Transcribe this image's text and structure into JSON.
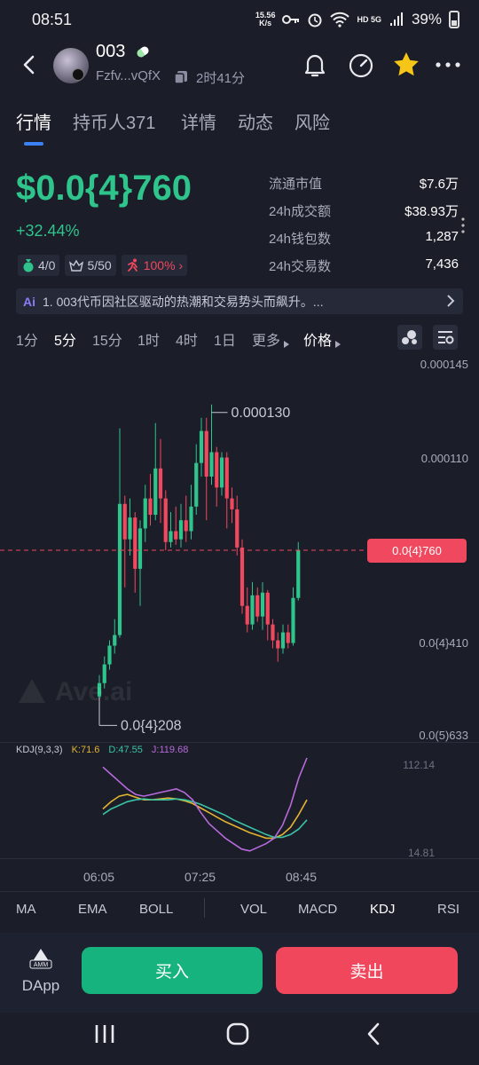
{
  "status_bar": {
    "time": "08:51",
    "speed_value": "15.56",
    "speed_unit": "K/s",
    "network": "HD 5G",
    "battery": "39%"
  },
  "header": {
    "token_name": "003",
    "address": "Fzfv...vQfX",
    "age": "2时41分"
  },
  "tabs": [
    {
      "label": "行情"
    },
    {
      "label": "持币人371"
    },
    {
      "label": "详情"
    },
    {
      "label": "动态"
    },
    {
      "label": "风险"
    }
  ],
  "price": {
    "value": "$0.0{4}760",
    "change": "+32.44%"
  },
  "badges": [
    {
      "text": "4/0"
    },
    {
      "text": "5/50"
    },
    {
      "text": "100%"
    }
  ],
  "stats": [
    {
      "label": "流通市值",
      "value": "$7.6万"
    },
    {
      "label": "24h成交额",
      "value": "$38.93万"
    },
    {
      "label": "24h钱包数",
      "value": "1,287"
    },
    {
      "label": "24h交易数",
      "value": "7,436"
    }
  ],
  "ai_banner": {
    "tag": "Ai",
    "text": "1. 003代币因社区驱动的热潮和交易势头而飙升。..."
  },
  "intervals": [
    {
      "label": "1分"
    },
    {
      "label": "5分"
    },
    {
      "label": "15分"
    },
    {
      "label": "1时"
    },
    {
      "label": "4时"
    },
    {
      "label": "1日"
    },
    {
      "label": "更多"
    },
    {
      "label": "价格"
    }
  ],
  "chart_data": {
    "type": "candlestick",
    "interval": "5分",
    "y_ticks": [
      "0.000145",
      "0.000110",
      "0.0{4}760",
      "0.0{4}410",
      "0.0(5)633"
    ],
    "y_tick_values": [
      0.000145,
      0.00011,
      7.6e-05,
      4.1e-05,
      6.33e-06
    ],
    "current_price_label": "0.0{4}760",
    "current_price": 7.6e-05,
    "high_label": "0.000130",
    "low_label": "0.0{4}208",
    "x_ticks": [
      "06:05",
      "07:25",
      "08:45"
    ],
    "candles": [
      {
        "o": 2.1e-05,
        "c": 2.6e-05,
        "h": 2.9e-05,
        "l": 2.08e-05
      },
      {
        "o": 2.6e-05,
        "c": 3.3e-05,
        "h": 3.6e-05,
        "l": 2.4e-05
      },
      {
        "o": 3.3e-05,
        "c": 4e-05,
        "h": 4.2e-05,
        "l": 3.1e-05
      },
      {
        "o": 4e-05,
        "c": 4.4e-05,
        "h": 5e-05,
        "l": 3.7e-05
      },
      {
        "o": 4.4e-05,
        "c": 9.3e-05,
        "h": 0.000121,
        "l": 4.3e-05
      },
      {
        "o": 9.3e-05,
        "c": 8e-05,
        "h": 9.6e-05,
        "l": 6.2e-05
      },
      {
        "o": 8e-05,
        "c": 8.8e-05,
        "h": 9.5e-05,
        "l": 7.4e-05
      },
      {
        "o": 8.8e-05,
        "c": 6.9e-05,
        "h": 9e-05,
        "l": 6e-05
      },
      {
        "o": 6.9e-05,
        "c": 8.4e-05,
        "h": 8.7e-05,
        "l": 5.5e-05
      },
      {
        "o": 8.4e-05,
        "c": 9.5e-05,
        "h": 0.0001,
        "l": 7.9e-05
      },
      {
        "o": 9.5e-05,
        "c": 8.9e-05,
        "h": 0.000104,
        "l": 8.5e-05
      },
      {
        "o": 8.9e-05,
        "c": 0.000106,
        "h": 0.000123,
        "l": 8.7e-05
      },
      {
        "o": 0.000106,
        "c": 9.5e-05,
        "h": 0.000117,
        "l": 8.6e-05
      },
      {
        "o": 9.5e-05,
        "c": 7.9e-05,
        "h": 9.8e-05,
        "l": 7.6e-05
      },
      {
        "o": 7.9e-05,
        "c": 8.3e-05,
        "h": 9e-05,
        "l": 7.7e-05
      },
      {
        "o": 8.3e-05,
        "c": 8e-05,
        "h": 9.2e-05,
        "l": 7.8e-05
      },
      {
        "o": 8e-05,
        "c": 8.7e-05,
        "h": 9.3e-05,
        "l": 7.7e-05
      },
      {
        "o": 8.7e-05,
        "c": 8.3e-05,
        "h": 9.6e-05,
        "l": 7.9e-05
      },
      {
        "o": 8.3e-05,
        "c": 9.2e-05,
        "h": 0.0001,
        "l": 8e-05
      },
      {
        "o": 9.2e-05,
        "c": 0.000108,
        "h": 0.000115,
        "l": 8.9e-05
      },
      {
        "o": 0.000108,
        "c": 0.00012,
        "h": 0.000125,
        "l": 0.000103
      },
      {
        "o": 0.00012,
        "c": 0.000103,
        "h": 0.000125,
        "l": 8.7e-05
      },
      {
        "o": 0.000103,
        "c": 0.000112,
        "h": 0.00013,
        "l": 0.0001
      },
      {
        "o": 0.000112,
        "c": 9.9e-05,
        "h": 0.000114,
        "l": 9.2e-05
      },
      {
        "o": 9.9e-05,
        "c": 0.00011,
        "h": 0.000112,
        "l": 9.6e-05
      },
      {
        "o": 0.00011,
        "c": 9.5e-05,
        "h": 0.000112,
        "l": 8.4e-05
      },
      {
        "o": 9.5e-05,
        "c": 9.1e-05,
        "h": 9.9e-05,
        "l": 8.6e-05
      },
      {
        "o": 9.1e-05,
        "c": 7.7e-05,
        "h": 9.6e-05,
        "l": 7.4e-05
      },
      {
        "o": 7.7e-05,
        "c": 5.5e-05,
        "h": 8e-05,
        "l": 5.2e-05
      },
      {
        "o": 5.5e-05,
        "c": 4.8e-05,
        "h": 6.2e-05,
        "l": 4.5e-05
      },
      {
        "o": 4.8e-05,
        "c": 5.9e-05,
        "h": 6.4e-05,
        "l": 4.6e-05
      },
      {
        "o": 5.9e-05,
        "c": 5.1e-05,
        "h": 6.2e-05,
        "l": 4.9e-05
      },
      {
        "o": 5.1e-05,
        "c": 6e-05,
        "h": 6.4e-05,
        "l": 4.6e-05
      },
      {
        "o": 6e-05,
        "c": 4.8e-05,
        "h": 6.1e-05,
        "l": 4.2e-05
      },
      {
        "o": 4.8e-05,
        "c": 4.2e-05,
        "h": 5e-05,
        "l": 3.9e-05
      },
      {
        "o": 4.2e-05,
        "c": 3.9e-05,
        "h": 4.5e-05,
        "l": 3.4e-05
      },
      {
        "o": 3.9e-05,
        "c": 4.5e-05,
        "h": 4.8e-05,
        "l": 3.7e-05
      },
      {
        "o": 4.5e-05,
        "c": 4.1e-05,
        "h": 4.8e-05,
        "l": 3.9e-05
      },
      {
        "o": 4.1e-05,
        "c": 5.8e-05,
        "h": 6.2e-05,
        "l": 4e-05
      },
      {
        "o": 5.8e-05,
        "c": 7.6e-05,
        "h": 7.9e-05,
        "l": 5.7e-05
      }
    ]
  },
  "kdj": {
    "label": "KDJ(9,3,3)",
    "k": "K:71.6",
    "d": "D:47.55",
    "j": "J:119.68",
    "ticks": [
      "112.14",
      "14.81"
    ],
    "tick_values": [
      112.14,
      14.81
    ],
    "series": [
      {
        "name": "K",
        "values": [
          62,
          70,
          76,
          78,
          75,
          72,
          72,
          73,
          74,
          73,
          71,
          68,
          63,
          58,
          53,
          48,
          44,
          40,
          36,
          33,
          30,
          30,
          34,
          42,
          56,
          72
        ]
      },
      {
        "name": "D",
        "values": [
          56,
          62,
          66,
          70,
          72,
          73,
          72,
          72,
          72,
          73,
          72,
          70,
          67,
          63,
          59,
          55,
          50,
          46,
          42,
          38,
          34,
          31,
          31,
          34,
          40,
          50
        ]
      },
      {
        "name": "J",
        "values": [
          108,
          100,
          92,
          84,
          78,
          76,
          78,
          80,
          82,
          84,
          80,
          72,
          58,
          46,
          38,
          30,
          24,
          18,
          16,
          20,
          24,
          30,
          44,
          66,
          96,
          118
        ]
      }
    ],
    "colors": {
      "k": "#e1b432",
      "d": "#39c4a6",
      "j": "#b76adc"
    }
  },
  "indicators": [
    {
      "label": "MA"
    },
    {
      "label": "EMA"
    },
    {
      "label": "BOLL"
    },
    {
      "label": "VOL"
    },
    {
      "label": "MACD"
    },
    {
      "label": "KDJ"
    },
    {
      "label": "RSI"
    }
  ],
  "bottom": {
    "dapp_badge": "AMM",
    "dapp_label": "DApp",
    "buy_label": "买入",
    "sell_label": "卖出"
  },
  "watermark": "Ave.ai",
  "colors": {
    "up": "#2ec48b",
    "down": "#f0485e",
    "accent": "#3b82f6",
    "background": "#1b1d28"
  }
}
